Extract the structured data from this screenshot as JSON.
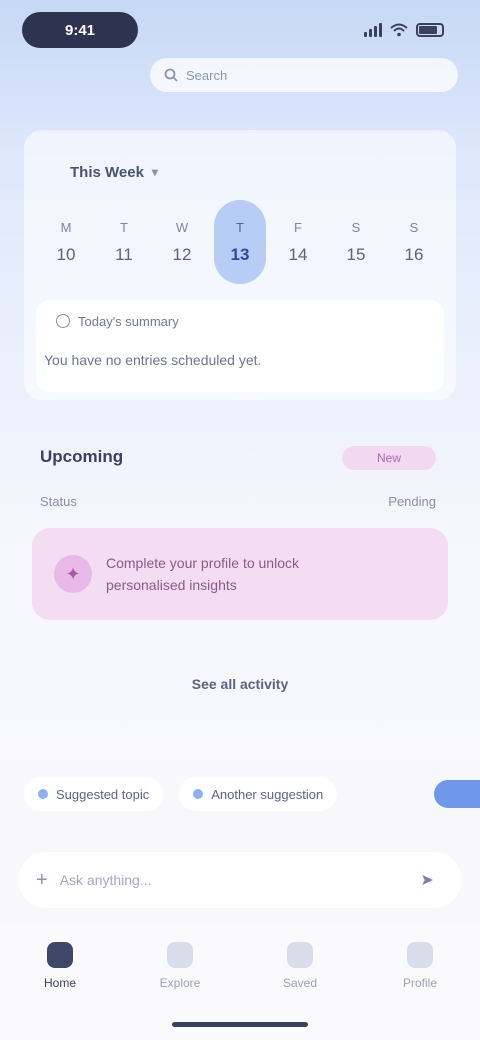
{
  "status_bar": {
    "time": "9:41"
  },
  "search": {
    "placeholder": "Search"
  },
  "calendar": {
    "title": "This Week",
    "days": [
      {
        "weekday": "M",
        "date": "10"
      },
      {
        "weekday": "T",
        "date": "11"
      },
      {
        "weekday": "W",
        "date": "12"
      },
      {
        "weekday": "T",
        "date": "13"
      },
      {
        "weekday": "F",
        "date": "14"
      },
      {
        "weekday": "S",
        "date": "15"
      },
      {
        "weekday": "S",
        "date": "16"
      }
    ],
    "selected_index": 3
  },
  "info": {
    "heading": "Today's summary",
    "body": "You have no entries scheduled yet."
  },
  "section": {
    "title": "Upcoming",
    "tag": "New",
    "row_label": "Status",
    "row_value": "Pending"
  },
  "promo": {
    "text_line1": "Complete your profile to unlock",
    "text_line2": "personalised insights"
  },
  "link": {
    "label": "See all activity"
  },
  "chips": [
    {
      "label": "Suggested topic"
    },
    {
      "label": "Another suggestion"
    }
  ],
  "input": {
    "placeholder": "Ask anything..."
  },
  "tabs": [
    {
      "label": "Home"
    },
    {
      "label": "Explore"
    },
    {
      "label": "Saved"
    },
    {
      "label": "Profile"
    }
  ],
  "colors": {
    "accent": "#6f97ea",
    "selected_day": "#b7cdf5",
    "promo_bg": "#f4dcf3"
  }
}
